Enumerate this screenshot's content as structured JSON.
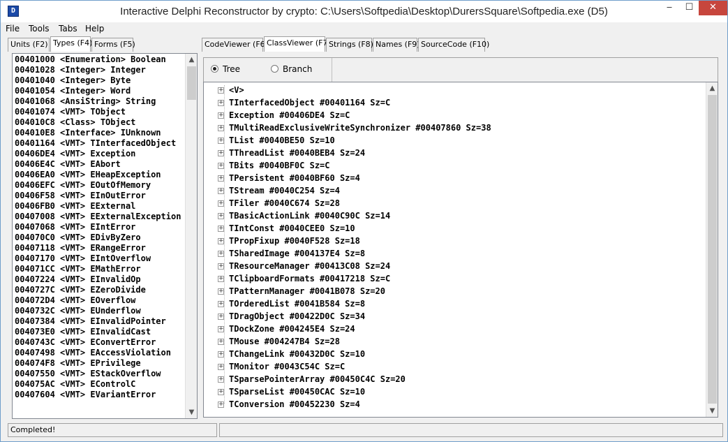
{
  "window": {
    "title": "Interactive Delphi Reconstructor by crypto: C:\\Users\\Softpedia\\Desktop\\DurersSquare\\Softpedia.exe (D5)",
    "min_glyph": "‒",
    "max_glyph": "☐",
    "close_glyph": "✕"
  },
  "menu": {
    "file": "File",
    "tools": "Tools",
    "tabs": "Tabs",
    "help": "Help"
  },
  "left": {
    "tabs": [
      "Units (F2)",
      "Types (F4)",
      "Forms (F5)"
    ],
    "active_tab": "Types (F4)",
    "types": [
      "00401000 <Enumeration> Boolean",
      "00401028 <Integer> Integer",
      "00401040 <Integer> Byte",
      "00401054 <Integer> Word",
      "00401068 <AnsiString> String",
      "00401074 <VMT> TObject",
      "004010C8 <Class> TObject",
      "004010E8 <Interface> IUnknown",
      "00401164 <VMT> TInterfacedObject",
      "00406DE4 <VMT> Exception",
      "00406E4C <VMT> EAbort",
      "00406EA0 <VMT> EHeapException",
      "00406EFC <VMT> EOutOfMemory",
      "00406F58 <VMT> EInOutError",
      "00406FB0 <VMT> EExternal",
      "00407008 <VMT> EExternalException",
      "00407068 <VMT> EIntError",
      "004070C0 <VMT> EDivByZero",
      "00407118 <VMT> ERangeError",
      "00407170 <VMT> EIntOverflow",
      "004071CC <VMT> EMathError",
      "00407224 <VMT> EInvalidOp",
      "0040727C <VMT> EZeroDivide",
      "004072D4 <VMT> EOverflow",
      "0040732C <VMT> EUnderflow",
      "00407384 <VMT> EInvalidPointer",
      "004073E0 <VMT> EInvalidCast",
      "0040743C <VMT> EConvertError",
      "00407498 <VMT> EAccessViolation",
      "004074F8 <VMT> EPrivilege",
      "00407550 <VMT> EStackOverflow",
      "004075AC <VMT> EControlC",
      "00407604 <VMT> EVariantError"
    ]
  },
  "right": {
    "tabs": [
      "CodeViewer (F6)",
      "ClassViewer (F7)",
      "Strings (F8)",
      "Names (F9)",
      "SourceCode (F10)"
    ],
    "active_tab": "ClassViewer (F7)",
    "radio_tree": "Tree",
    "radio_branch": "Branch",
    "tree_items": [
      "<V>",
      "TInterfacedObject #00401164 Sz=C",
      "Exception #00406DE4 Sz=C",
      "TMultiReadExclusiveWriteSynchronizer #00407860 Sz=38",
      "TList #0040BE50 Sz=10",
      "TThreadList #0040BEB4 Sz=24",
      "TBits #0040BF0C Sz=C",
      "TPersistent #0040BF60 Sz=4",
      "TStream #0040C254 Sz=4",
      "TFiler #0040C674 Sz=28",
      "TBasicActionLink #0040C90C Sz=14",
      "TIntConst #0040CEE0 Sz=10",
      "TPropFixup #0040F528 Sz=18",
      "TSharedImage #004137E4 Sz=8",
      "TResourceManager #00413C08 Sz=24",
      "TClipboardFormats #00417218 Sz=C",
      "TPatternManager #0041B078 Sz=20",
      "TOrderedList #0041B584 Sz=8",
      "TDragObject #00422D0C Sz=34",
      "TDockZone #004245E4 Sz=24",
      "TMouse #004247B4 Sz=28",
      "TChangeLink #00432D0C Sz=10",
      "TMonitor #0043C54C Sz=C",
      "TSparsePointerArray #00450C4C Sz=20",
      "TSparseList #00450CAC Sz=10",
      "TConversion #00452230 Sz=4"
    ]
  },
  "status": {
    "text": "Completed!"
  }
}
